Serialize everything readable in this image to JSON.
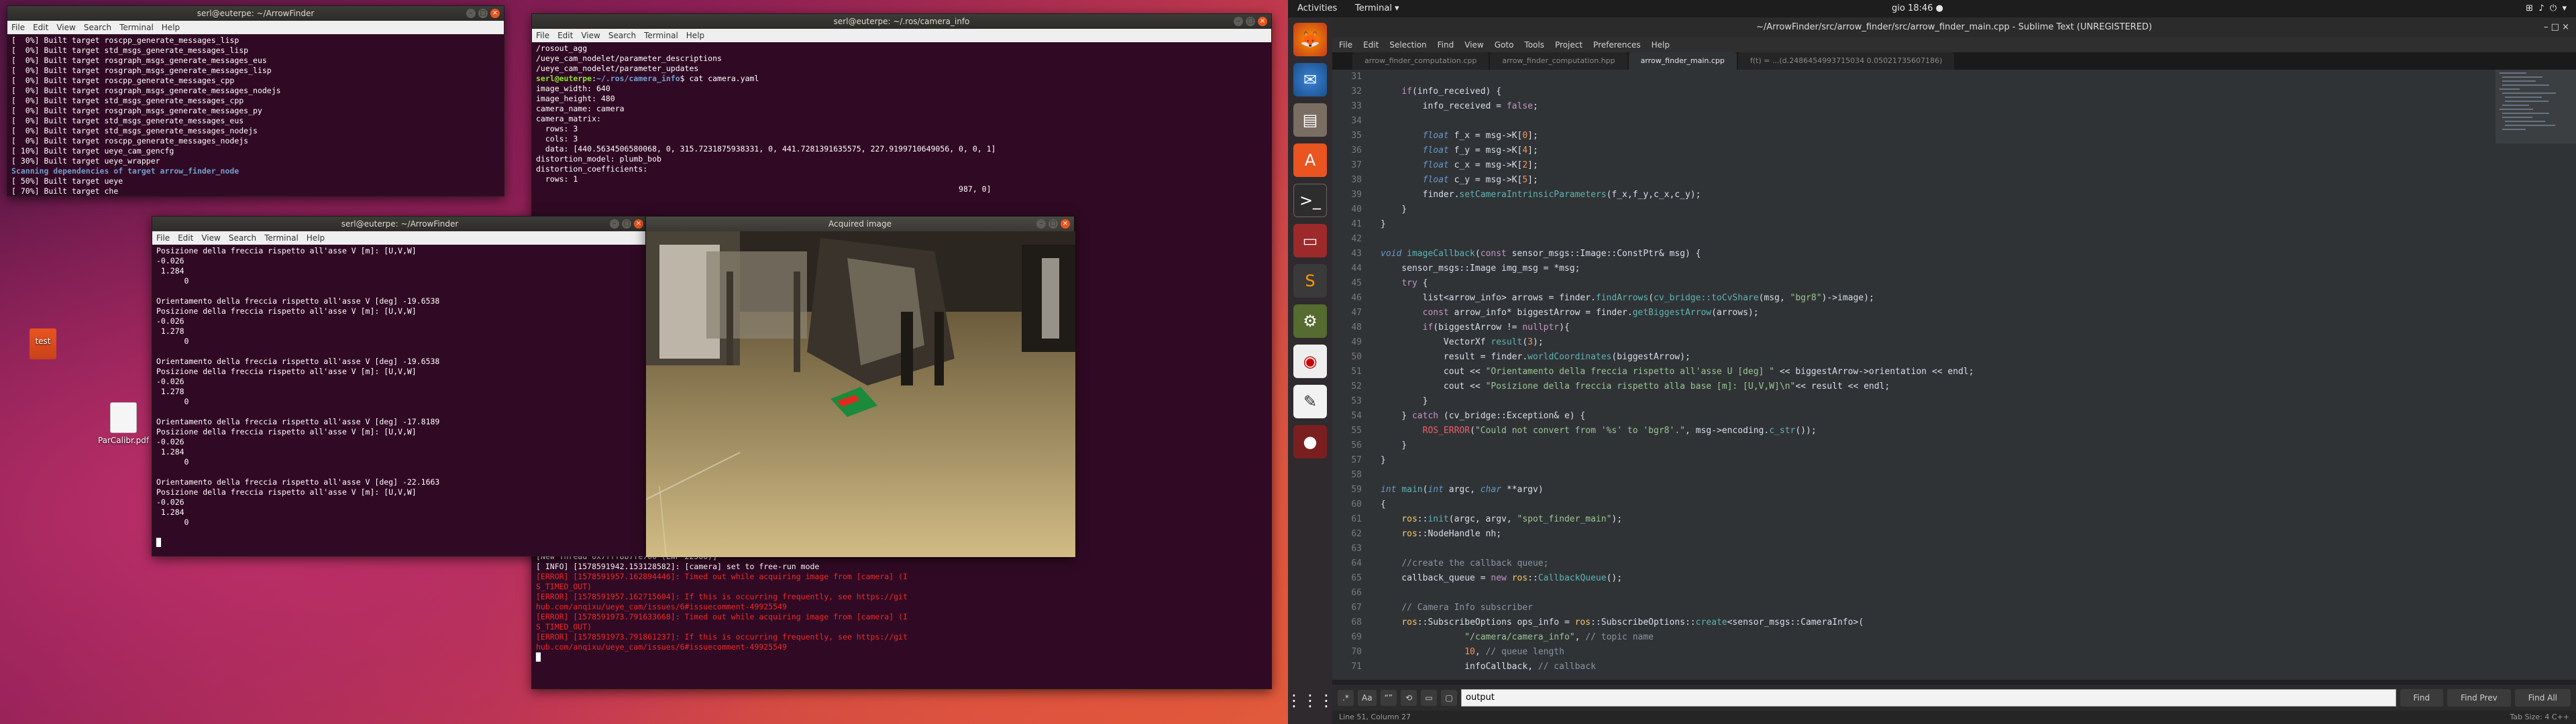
{
  "left": {
    "terminal1": {
      "title": "serl@euterpe: ~/ArrowFinder",
      "menu": [
        "File",
        "Edit",
        "View",
        "Search",
        "Terminal",
        "Help"
      ]
    },
    "terminal2": {
      "title": "serl@euterpe: ~/.ros/camera_info",
      "menu": [
        "File",
        "Edit",
        "View",
        "Search",
        "Terminal",
        "Help"
      ]
    },
    "terminal3": {
      "title": "serl@euterpe: ~/ArrowFinder",
      "menu": [
        "File",
        "Edit",
        "View",
        "Search",
        "Terminal",
        "Help"
      ]
    },
    "image_window": {
      "title": "Acquired image"
    },
    "desktop_icons": [
      {
        "label": "test"
      },
      {
        "label": "ParCalibr.pdf"
      }
    ]
  },
  "topbar": {
    "activities": "Activities",
    "app": "Terminal ▾",
    "clock": "gio 18:46 ●"
  },
  "sublime": {
    "title": "~/ArrowFinder/src/arrow_finder/src/arrow_finder_main.cpp - Sublime Text (UNREGISTERED)",
    "menu": [
      "File",
      "Edit",
      "Selection",
      "Find",
      "View",
      "Goto",
      "Tools",
      "Project",
      "Preferences",
      "Help"
    ],
    "tabs": [
      "arrow_finder_computation.cpp",
      "arrow_finder_computation.hpp",
      "arrow_finder_main.cpp",
      "f(t) = ...(d.2486454993715034 0.05021735607186)"
    ],
    "find": {
      "value": "output",
      "find": "Find",
      "find_prev": "Find Prev",
      "find_all": "Find All",
      "aa": "Aa"
    },
    "status": {
      "left": "Line 51, Column 27",
      "right": "Tab Size: 4        C++"
    }
  }
}
